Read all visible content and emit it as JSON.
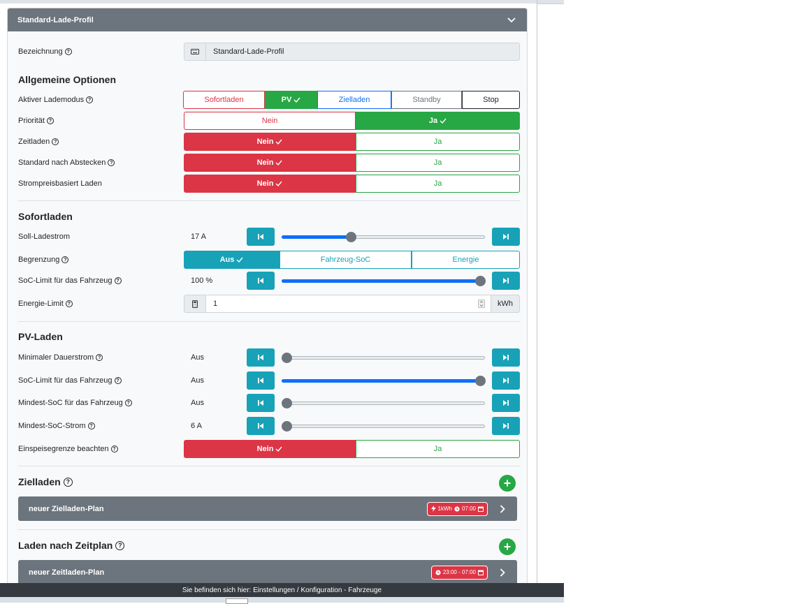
{
  "card": {
    "title": "Standard-Lade-Profil"
  },
  "bezeichnung": {
    "label": "Bezeichnung",
    "value": "Standard-Lade-Profil"
  },
  "allgemein": {
    "title": "Allgemeine Optionen",
    "lademodus": {
      "label": "Aktiver Lademodus",
      "options": [
        "Sofortladen",
        "PV",
        "Zielladen",
        "Standby",
        "Stop"
      ],
      "selected": "PV"
    },
    "prioritaet": {
      "label": "Priorität",
      "no": "Nein",
      "yes": "Ja",
      "selected": "Ja"
    },
    "zeitladen": {
      "label": "Zeitladen",
      "no": "Nein",
      "yes": "Ja",
      "selected": "Nein"
    },
    "standard": {
      "label": "Standard nach Abstecken",
      "no": "Nein",
      "yes": "Ja",
      "selected": "Nein"
    },
    "strompreis": {
      "label": "Strompreisbasiert Laden",
      "no": "Nein",
      "yes": "Ja",
      "selected": "Nein"
    }
  },
  "sofort": {
    "title": "Sofortladen",
    "ladestrom": {
      "label": "Soll-Ladestrom",
      "display": "17 A",
      "fraction": 0.34
    },
    "begrenzung": {
      "label": "Begrenzung",
      "options": [
        "Aus",
        "Fahrzeug-SoC",
        "Energie"
      ],
      "selected": "Aus"
    },
    "soclimit": {
      "label": "SoC-Limit für das Fahrzeug",
      "display": "100 %",
      "fraction": 1.0
    },
    "energielimit": {
      "label": "Energie-Limit",
      "value": "1",
      "unit": "kWh"
    }
  },
  "pv": {
    "title": "PV-Laden",
    "dauerstrom": {
      "label": "Minimaler Dauerstrom",
      "display": "Aus",
      "fraction": 0
    },
    "soclimit": {
      "label": "SoC-Limit für das Fahrzeug",
      "display": "Aus",
      "fraction": 1.0
    },
    "mindestsoc": {
      "label": "Mindest-SoC für das Fahrzeug",
      "display": "Aus",
      "fraction": 0
    },
    "mindestsocstrom": {
      "label": "Mindest-SoC-Strom",
      "display": "6 A",
      "fraction": 0
    },
    "einspeise": {
      "label": "Einspeisegrenze beachten",
      "no": "Nein",
      "yes": "Ja",
      "selected": "Nein"
    }
  },
  "ziel": {
    "title": "Zielladen",
    "plan": {
      "name": "neuer Zielladen-Plan",
      "energy": "1kWh",
      "time": "07:00"
    }
  },
  "zeitplan": {
    "title": "Laden nach Zeitplan",
    "plan": {
      "name": "neuer Zeitladen-Plan",
      "time": "23:00 - 07:00"
    }
  },
  "footer": {
    "text": "Sie befinden sich hier: Einstellungen / Konfiguration - Fahrzeuge"
  },
  "colors": {
    "danger": "#dc3545",
    "success": "#28a745",
    "info": "#17a2b8",
    "secondary": "#6c757d",
    "primary": "#0d6efd"
  }
}
